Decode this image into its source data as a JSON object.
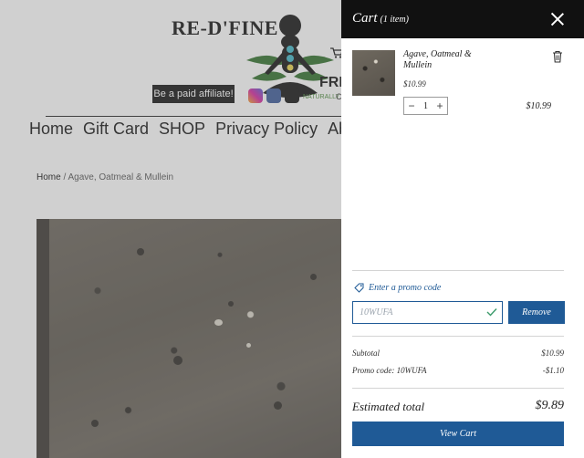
{
  "site": {
    "title": "RE-D'FINE  E",
    "free_text": "FRE",
    "affiliate_button": "Be a paid affiliate!",
    "small_link": "NATURALLY GOOD AND MORE",
    "small_c": "C",
    "nav": [
      "Home",
      "Gift Card",
      "SHOP",
      "Privacy Policy",
      "Ab"
    ],
    "breadcrumb": {
      "home": "Home",
      "separator": "/",
      "current": "Agave, Oatmeal & Mullein"
    }
  },
  "cart": {
    "title": "Cart",
    "count": "(1 item)",
    "item": {
      "name": "Agave, Oatmeal & Mullein",
      "price": "$10.99",
      "quantity": "1",
      "line_total": "$10.99"
    },
    "promo": {
      "link_label": "Enter a promo code",
      "code": "10WUFA",
      "remove_label": "Remove"
    },
    "summary": {
      "subtotal_label": "Subtotal",
      "subtotal_value": "$10.99",
      "promo_label": "Promo code: 10WUFA",
      "promo_value": "-$1.10",
      "estimated_label": "Estimated total",
      "estimated_value": "$9.89"
    },
    "view_cart_label": "View Cart"
  },
  "colors": {
    "accent": "#1f5a96",
    "header": "#111111"
  }
}
